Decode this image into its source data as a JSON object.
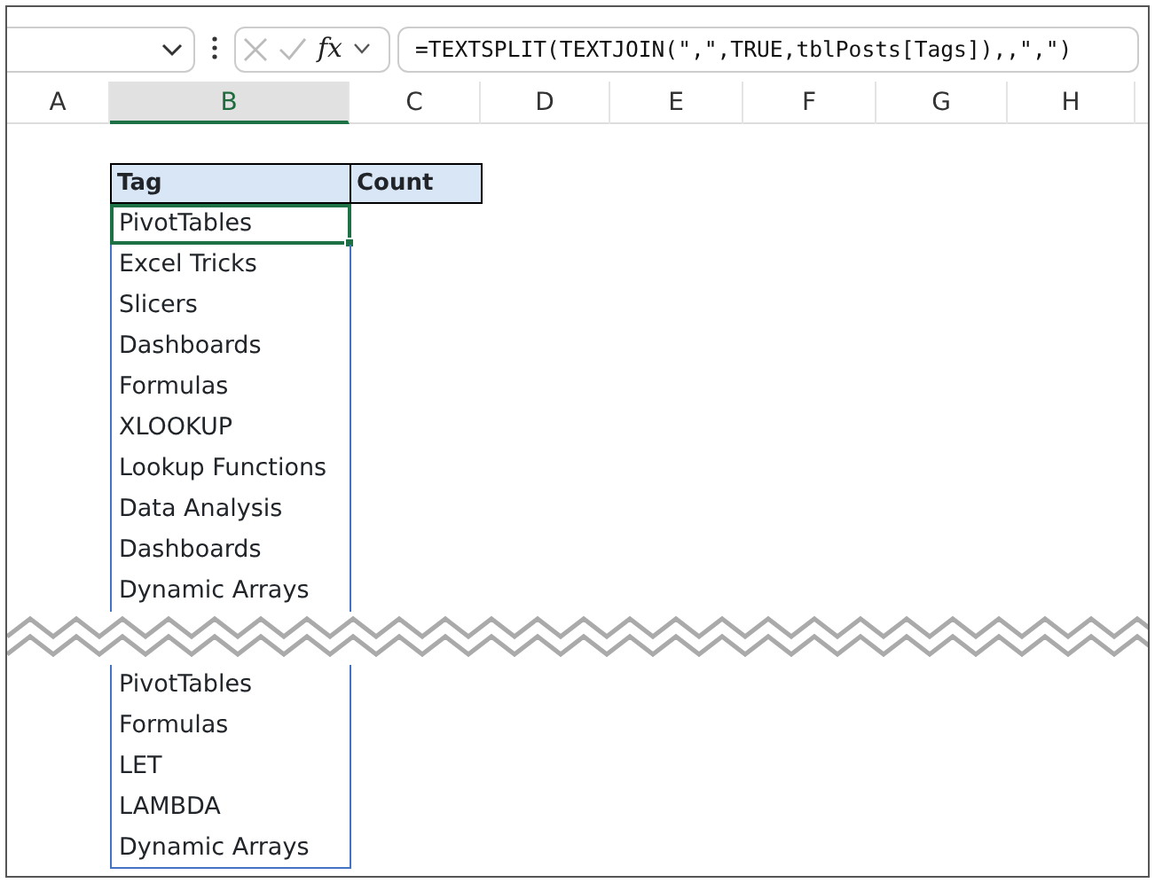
{
  "formula_bar": {
    "formula": "=TEXTSPLIT(TEXTJOIN(\",\",TRUE,tblPosts[Tags]),,\",\")",
    "fx_label": "fx"
  },
  "columns": [
    {
      "label": "A",
      "selected": false
    },
    {
      "label": "B",
      "selected": true
    },
    {
      "label": "C",
      "selected": false
    },
    {
      "label": "D",
      "selected": false
    },
    {
      "label": "E",
      "selected": false
    },
    {
      "label": "F",
      "selected": false
    },
    {
      "label": "G",
      "selected": false
    },
    {
      "label": "H",
      "selected": false
    }
  ],
  "table": {
    "headers": [
      "Tag",
      "Count"
    ],
    "rows_before_break": [
      {
        "tag": "PivotTables",
        "selected": true
      },
      {
        "tag": "Excel Tricks",
        "selected": false
      },
      {
        "tag": "Slicers",
        "selected": false
      },
      {
        "tag": "Dashboards",
        "selected": false
      },
      {
        "tag": "Formulas",
        "selected": false
      },
      {
        "tag": "XLOOKUP",
        "selected": false
      },
      {
        "tag": "Lookup Functions",
        "selected": false
      },
      {
        "tag": "Data Analysis",
        "selected": false
      },
      {
        "tag": "Dashboards",
        "selected": false
      },
      {
        "tag": "Dynamic Arrays",
        "selected": false
      }
    ],
    "rows_after_break": [
      {
        "tag": "PivotTables",
        "selected": false
      },
      {
        "tag": "Formulas",
        "selected": false
      },
      {
        "tag": "LET",
        "selected": false
      },
      {
        "tag": "LAMBDA",
        "selected": false
      },
      {
        "tag": "Dynamic Arrays",
        "selected": false
      }
    ]
  }
}
